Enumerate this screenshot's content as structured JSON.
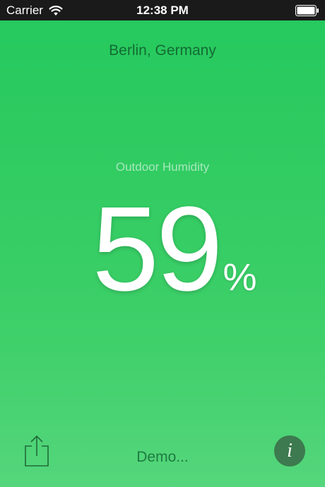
{
  "status_bar": {
    "carrier": "Carrier",
    "time": "12:38 PM",
    "wifi_icon": "wifi-icon",
    "battery_icon": "battery-icon"
  },
  "location": "Berlin, Germany",
  "metric": {
    "label": "Outdoor Humidity",
    "value": "59",
    "unit": "%"
  },
  "footer": {
    "share_icon": "share-icon",
    "demo_text": "Demo...",
    "info_label": "i"
  },
  "colors": {
    "background_top": "#24c95d",
    "background_bottom": "#55d67c",
    "location_text": "#136b34",
    "label_text": "#a6e8bd",
    "info_button": "#3d7a4f"
  }
}
